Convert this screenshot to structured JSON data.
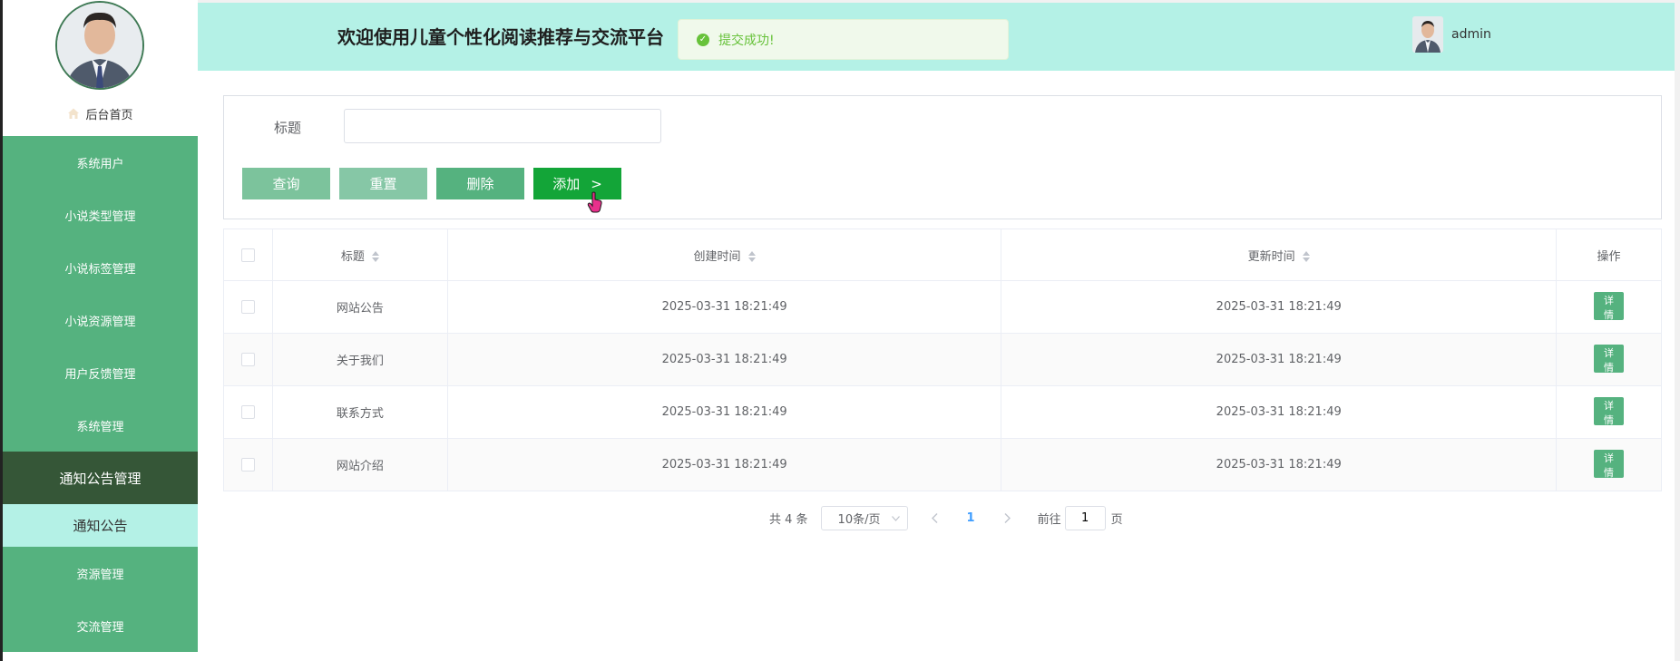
{
  "header": {
    "title": "欢迎使用儿童个性化阅读推荐与交流平台",
    "toast": "提交成功!",
    "username": "admin"
  },
  "sidebar": {
    "home": "后台首页",
    "items": [
      {
        "label": "系统用户"
      },
      {
        "label": "小说类型管理"
      },
      {
        "label": "小说标签管理"
      },
      {
        "label": "小说资源管理"
      },
      {
        "label": "用户反馈管理"
      },
      {
        "label": "系统管理"
      },
      {
        "label": "通知公告管理",
        "active": true
      },
      {
        "label": "通知公告",
        "sub": true
      },
      {
        "label": "资源管理"
      },
      {
        "label": "交流管理"
      }
    ]
  },
  "search": {
    "label": "标题",
    "value": "",
    "buttons": {
      "query": "查询",
      "reset": "重置",
      "delete": "删除",
      "add": "添加",
      "add_arrow": ">"
    }
  },
  "table": {
    "headers": [
      "标题",
      "创建时间",
      "更新时间",
      "操作"
    ],
    "rows": [
      {
        "title": "网站公告",
        "created": "2025-03-31 18:21:49",
        "updated": "2025-03-31 18:21:49",
        "action": "详情"
      },
      {
        "title": "关于我们",
        "created": "2025-03-31 18:21:49",
        "updated": "2025-03-31 18:21:49",
        "action": "详情"
      },
      {
        "title": "联系方式",
        "created": "2025-03-31 18:21:49",
        "updated": "2025-03-31 18:21:49",
        "action": "详情"
      },
      {
        "title": "网站介绍",
        "created": "2025-03-31 18:21:49",
        "updated": "2025-03-31 18:21:49",
        "action": "详情"
      }
    ]
  },
  "pagination": {
    "total": "共 4 条",
    "page_size": "10条/页",
    "current_page": "1",
    "goto_label": "前往",
    "goto_value": "1",
    "page_unit": "页"
  },
  "colors": {
    "sidebar_green": "#55b27f",
    "sidebar_active": "#355637",
    "header_bg": "#b4f1e6",
    "add_button": "#13a538",
    "toast_text": "#67c23a",
    "page_active": "#409eff"
  }
}
